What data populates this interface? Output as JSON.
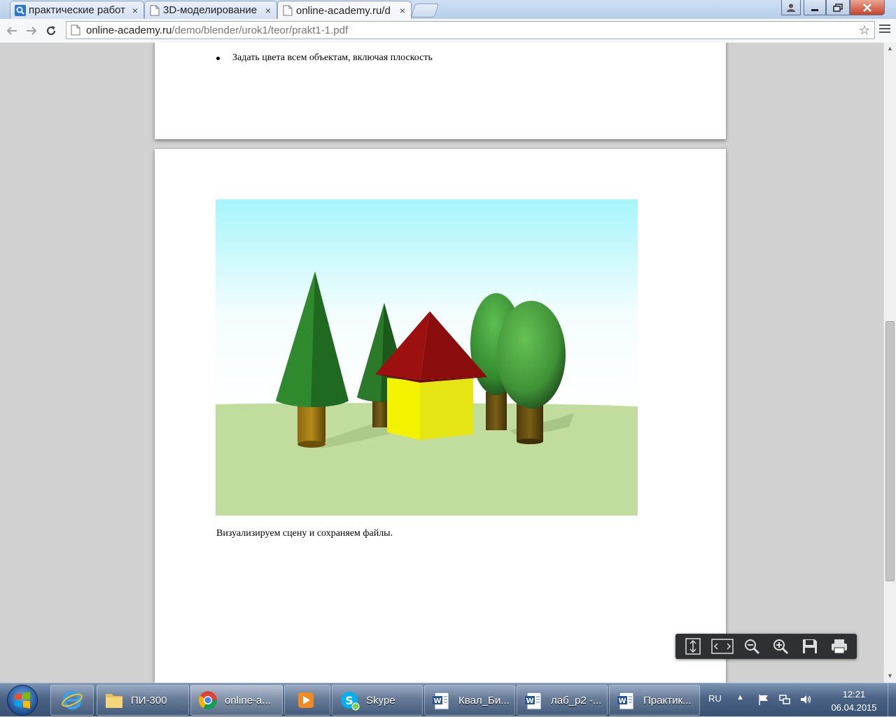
{
  "browser": {
    "tabs": [
      {
        "label": "практические работ",
        "icon": "search-favicon-icon",
        "active": false
      },
      {
        "label": "3D-моделирование",
        "icon": "page-icon",
        "active": false
      },
      {
        "label": "online-academy.ru/d",
        "icon": "page-icon",
        "active": true
      }
    ],
    "close_glyph": "×",
    "url_host": "online-academy.ru",
    "url_path": "/demo/blender/urok1/teor/prakt1-1.pdf"
  },
  "document": {
    "bullet_text": "Задать цвета всем объектам, включая плоскость",
    "caption": "Визуализируем сцену и сохраняем файлы."
  },
  "pdf_toolbar": {
    "buttons": [
      "fit-page-icon",
      "fit-width-icon",
      "zoom-out-icon",
      "zoom-in-icon",
      "save-icon",
      "print-icon"
    ]
  },
  "taskbar": {
    "items": [
      {
        "label": "ПИ-300",
        "icon": "folder-icon"
      },
      {
        "label": "online-a...",
        "icon": "chrome-icon"
      },
      {
        "label": "",
        "icon": "media-player-icon"
      },
      {
        "label": "Skype",
        "icon": "skype-icon"
      },
      {
        "label": "Квал_Би...",
        "icon": "word-doc-icon"
      },
      {
        "label": "лаб_р2 -...",
        "icon": "word-doc-icon"
      },
      {
        "label": "Практик...",
        "icon": "word-doc-icon"
      }
    ],
    "language": "RU",
    "time": "12:21",
    "date": "06.04.2015"
  }
}
